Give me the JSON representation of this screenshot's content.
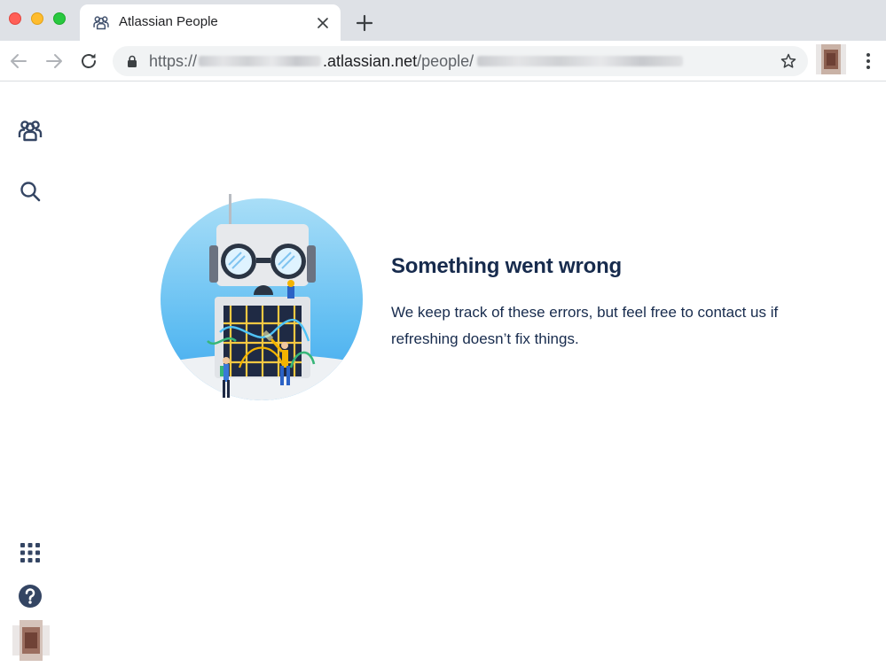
{
  "browser": {
    "tab": {
      "title": "Atlassian People",
      "favicon": "people-icon"
    },
    "address_bar": {
      "scheme": "https://",
      "domain": ".atlassian.net",
      "path": "/people/"
    }
  },
  "sidebar": {
    "top_items": [
      "people-icon",
      "search-icon"
    ],
    "bottom_items": [
      "app-switcher-icon",
      "help-icon",
      "avatar"
    ]
  },
  "error": {
    "title": "Something went wrong",
    "message": "We keep track of these errors, but feel free to contact us if refreshing doesn’t fix things."
  },
  "colors": {
    "text_primary": "#172b4d",
    "illustration_sky": "#79c9f5",
    "chrome_frame": "#dee1e6"
  }
}
